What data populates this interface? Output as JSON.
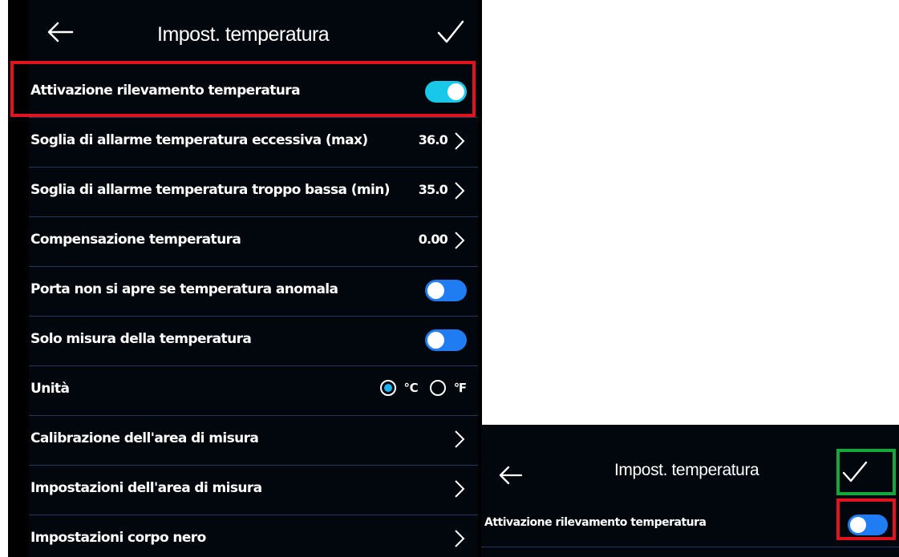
{
  "main": {
    "title": "Impost. temperatura",
    "rows": [
      {
        "label": "Attivazione rilevamento temperatura",
        "type": "toggle",
        "state": "on"
      },
      {
        "label": "Soglia di allarme temperatura eccessiva (max)",
        "type": "value",
        "value": "36.0"
      },
      {
        "label": "Soglia di allarme temperatura troppo bassa (min)",
        "type": "value",
        "value": "35.0"
      },
      {
        "label": "Compensazione temperatura",
        "type": "value",
        "value": "0.00"
      },
      {
        "label": "Porta non si apre se temperatura anomala",
        "type": "toggle",
        "state": "off"
      },
      {
        "label": "Solo misura della temperatura",
        "type": "toggle",
        "state": "off"
      },
      {
        "label": "Unità",
        "type": "radio",
        "options": [
          "℃",
          "℉"
        ],
        "selected": "℃"
      },
      {
        "label": "Calibrazione dell'area di misura",
        "type": "link"
      },
      {
        "label": "Impostazioni dell'area di misura",
        "type": "link"
      },
      {
        "label": "Impostazioni corpo nero",
        "type": "link"
      }
    ]
  },
  "inset": {
    "title": "Impost. temperatura",
    "row": {
      "label": "Attivazione rilevamento temperatura",
      "type": "toggle",
      "state": "off"
    }
  },
  "colors": {
    "background": "#02070d",
    "toggle_on": "#17c8e8",
    "toggle_off": "#1f7cf2",
    "highlight_red": "#e1131f",
    "highlight_green": "#14a83c"
  }
}
